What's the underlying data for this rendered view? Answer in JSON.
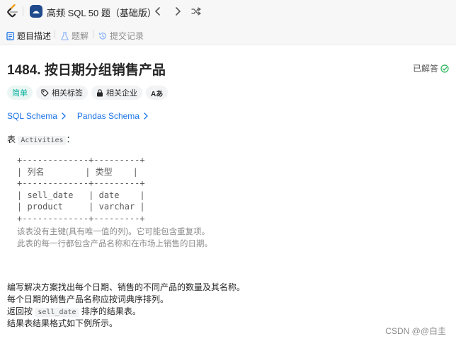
{
  "topbar": {
    "study_plan_title": "高频 SQL 50 题（基础版）",
    "icons": [
      "leetcode-logo-icon",
      "study-plan-icon",
      "chevron-left-icon",
      "chevron-right-icon",
      "shuffle-icon"
    ]
  },
  "tabs": [
    {
      "label": "题目描述",
      "icon": "description-icon",
      "active": true
    },
    {
      "label": "题解",
      "icon": "flask-icon",
      "active": false
    },
    {
      "label": "提交记录",
      "icon": "history-icon",
      "active": false
    }
  ],
  "problem": {
    "title": "1484. 按日期分组销售产品",
    "status": "已解答",
    "status_color": "#2db55d"
  },
  "tags": {
    "difficulty": "简单",
    "related_tags": "相关标签",
    "related_companies": "相关企业",
    "translate": "Aあ"
  },
  "schema_links": [
    "SQL Schema",
    "Pandas Schema"
  ],
  "intro": {
    "prefix": "表 ",
    "table_name": "Activities",
    "suffix": "："
  },
  "table_block": {
    "border_line": "+-------------+---------+",
    "header": "| 列名        | 类型    |",
    "rows": [
      "| sell_date   | date    |",
      "| product     | varchar |"
    ],
    "notes": [
      "该表没有主键(具有唯一值的列)。它可能包含重复项。",
      "此表的每一行都包含产品名称和在市场上销售的日期。"
    ]
  },
  "description": {
    "line1": "编写解决方案找出每个日期、销售的不同产品的数量及其名称。",
    "line2": "每个日期的销售产品名称应按词典序排列。",
    "line3_prefix": "返回按 ",
    "line3_code": "sell_date",
    "line3_suffix": " 排序的结果表。",
    "line4": "结果表结果格式如下例所示。"
  },
  "watermark": "CSDN @@白圭",
  "colors": {
    "accent_link": "#1a73e8",
    "easy_green": "#00af9b",
    "logo_orange": "#ffa116"
  }
}
